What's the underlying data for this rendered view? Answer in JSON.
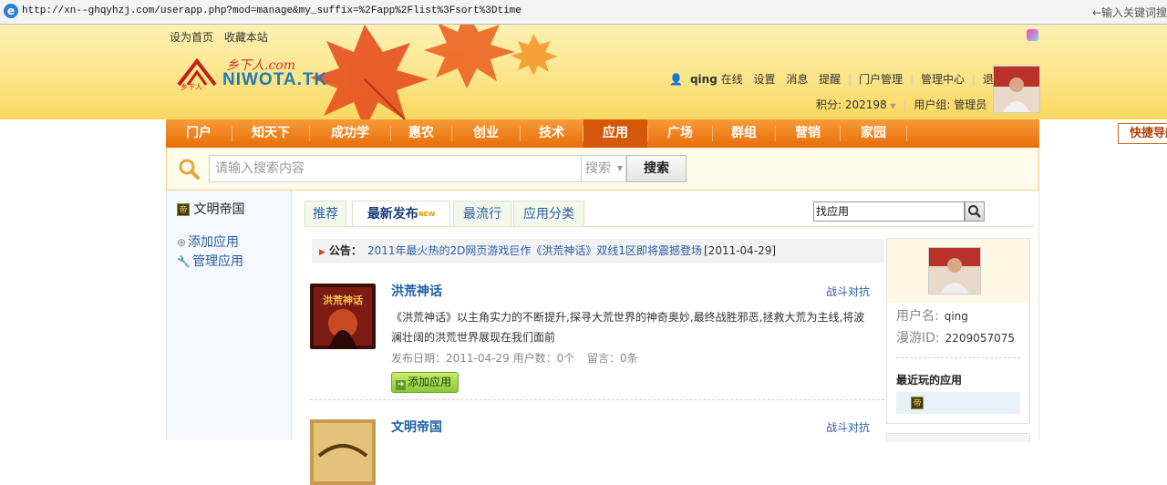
{
  "browser": {
    "url": "http://xn--ghqyhzj.com/userapp.php?mod=manage&my_suffix=%2Fapp%2Flist%3Fsort%3Dtime",
    "keyword_hint": "←输入关键词搜"
  },
  "header": {
    "set_homepage": "设为首页",
    "bookmark": "收藏本站",
    "logo_cn": "乡下人.com",
    "logo_en": "NIWOTA.TK",
    "logo_small": "乡下人"
  },
  "user": {
    "name": "qing",
    "online": "在线",
    "links": [
      "设置",
      "消息",
      "提醒",
      "门户管理",
      "管理中心",
      "退出"
    ],
    "points_label": "积分: 202198",
    "group_label": "用户组: 管理员"
  },
  "nav": {
    "items": [
      "门户",
      "知天下",
      "成功学",
      "惠农",
      "创业",
      "技术",
      "应用",
      "广场",
      "群组",
      "营销",
      "家园"
    ],
    "active": "应用",
    "quick_nav": "快捷导航"
  },
  "search": {
    "placeholder": "请输入搜索内容",
    "type": "搜索",
    "button": "搜索"
  },
  "sidebar": {
    "app_title": "文明帝国",
    "app_icon": "帝",
    "add_app": "添加应用",
    "manage_app": "管理应用"
  },
  "tabs": {
    "items": [
      "推荐",
      "最新发布",
      "最流行",
      "应用分类"
    ],
    "active": "最新发布",
    "new_badge": "NEW",
    "find_placeholder": "找应用"
  },
  "notice": {
    "label": "公告：",
    "text": "2011年最火热的2D网页游戏巨作《洪荒神话》双线1区即将震撼登场",
    "date": "[2011-04-29]"
  },
  "apps": [
    {
      "name": "洪荒神话",
      "category": "战斗对抗",
      "thumb_text": "洪荒神话",
      "desc": "《洪荒神话》以主角实力的不断提升,探寻大荒世界的神奇奥妙,最终战胜邪恶,拯救大荒为主线,将波澜壮阔的洪荒世界展现在我们面前",
      "date": "发布日期：2011-04-29",
      "users": "用户数：0个",
      "comments": "留言：0条",
      "add_label": "添加应用"
    },
    {
      "name": "文明帝国",
      "category": "战斗对抗"
    }
  ],
  "profile": {
    "username_label": "用户名:",
    "username": "qing",
    "id_label": "漫游ID:",
    "id": "2209057075",
    "recent_title": "最近玩的应用",
    "recent_icon": "帝"
  }
}
